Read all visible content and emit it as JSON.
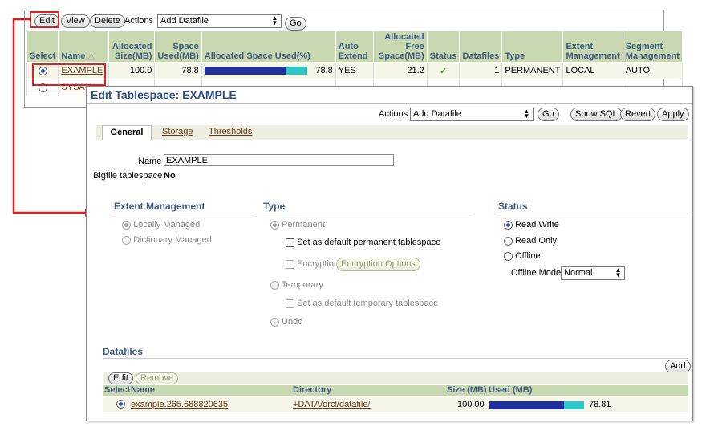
{
  "toolbar": {
    "edit": "Edit",
    "view": "View",
    "delete": "Delete",
    "actions_label": "Actions",
    "actions_value": "Add Datafile",
    "go": "Go"
  },
  "table": {
    "headers": {
      "select": "Select",
      "name": "Name",
      "allocated_size": [
        "Allocated",
        "Size(MB)"
      ],
      "space_used": [
        "Space",
        "Used(MB)"
      ],
      "allocated_pct": "Allocated Space Used(%)",
      "auto_extend": [
        "Auto",
        "Extend"
      ],
      "allocated_free": [
        "Allocated",
        "Free",
        "Space(MB)"
      ],
      "status": "Status",
      "datafiles": "Datafiles",
      "type": "Type",
      "extent_mgmt": [
        "Extent",
        "Management"
      ],
      "segment_mgmt": [
        "Segment",
        "Management"
      ]
    },
    "rows": [
      {
        "name": "EXAMPLE",
        "allocated_size": "100.0",
        "space_used": "78.8",
        "pct_used": 78.8,
        "pct_label": "78.8",
        "auto_extend": "YES",
        "free": "21.2",
        "status": "✓",
        "datafiles": "1",
        "type": "PERMANENT",
        "extent": "LOCAL",
        "segment": "AUTO"
      },
      {
        "name": "SYSAU"
      }
    ]
  },
  "dialog": {
    "title": "Edit Tablespace: EXAMPLE",
    "actions_label": "Actions",
    "actions_value": "Add Datafile",
    "go": "Go",
    "show_sql": "Show SQL",
    "revert": "Revert",
    "apply": "Apply",
    "tabs": [
      "General",
      "Storage",
      "Thresholds"
    ],
    "name_label": "Name",
    "name_value": "EXAMPLE",
    "bigfile_label": "Bigfile tablespace",
    "bigfile_value": "No",
    "extent": {
      "title": "Extent Management",
      "locally": "Locally Managed",
      "dictionary": "Dictionary Managed"
    },
    "type": {
      "title": "Type",
      "permanent": "Permanent",
      "default_perm": "Set as default permanent tablespace",
      "encryption": "Encryption",
      "encryption_options": "Encryption Options",
      "temporary": "Temporary",
      "default_temp": "Set as default temporary tablespace",
      "undo": "Undo"
    },
    "status": {
      "title": "Status",
      "read_write": "Read Write",
      "read_only": "Read Only",
      "offline": "Offline",
      "offline_mode_label": "Offline Mode",
      "offline_mode_value": "Normal"
    },
    "datafiles": {
      "title": "Datafiles",
      "add": "Add",
      "edit": "Edit",
      "remove": "Remove",
      "headers": {
        "select": "Select",
        "name": "Name",
        "directory": "Directory",
        "size": "Size (MB)",
        "used": "Used (MB)"
      },
      "rows": [
        {
          "name": "example.265.688820635",
          "directory": "+DATA/orcl/datafile/",
          "size": "100.00",
          "used_pct": 78.81,
          "used_label": "78.81"
        }
      ]
    }
  },
  "colors": {
    "header_bg": "#c8d8b0",
    "header_text": "#3d5a80",
    "bar_used": "#1e2f9a",
    "bar_free": "#2ec8c8",
    "highlight_red": "#e02020",
    "check_green": "#2a9a2a"
  }
}
